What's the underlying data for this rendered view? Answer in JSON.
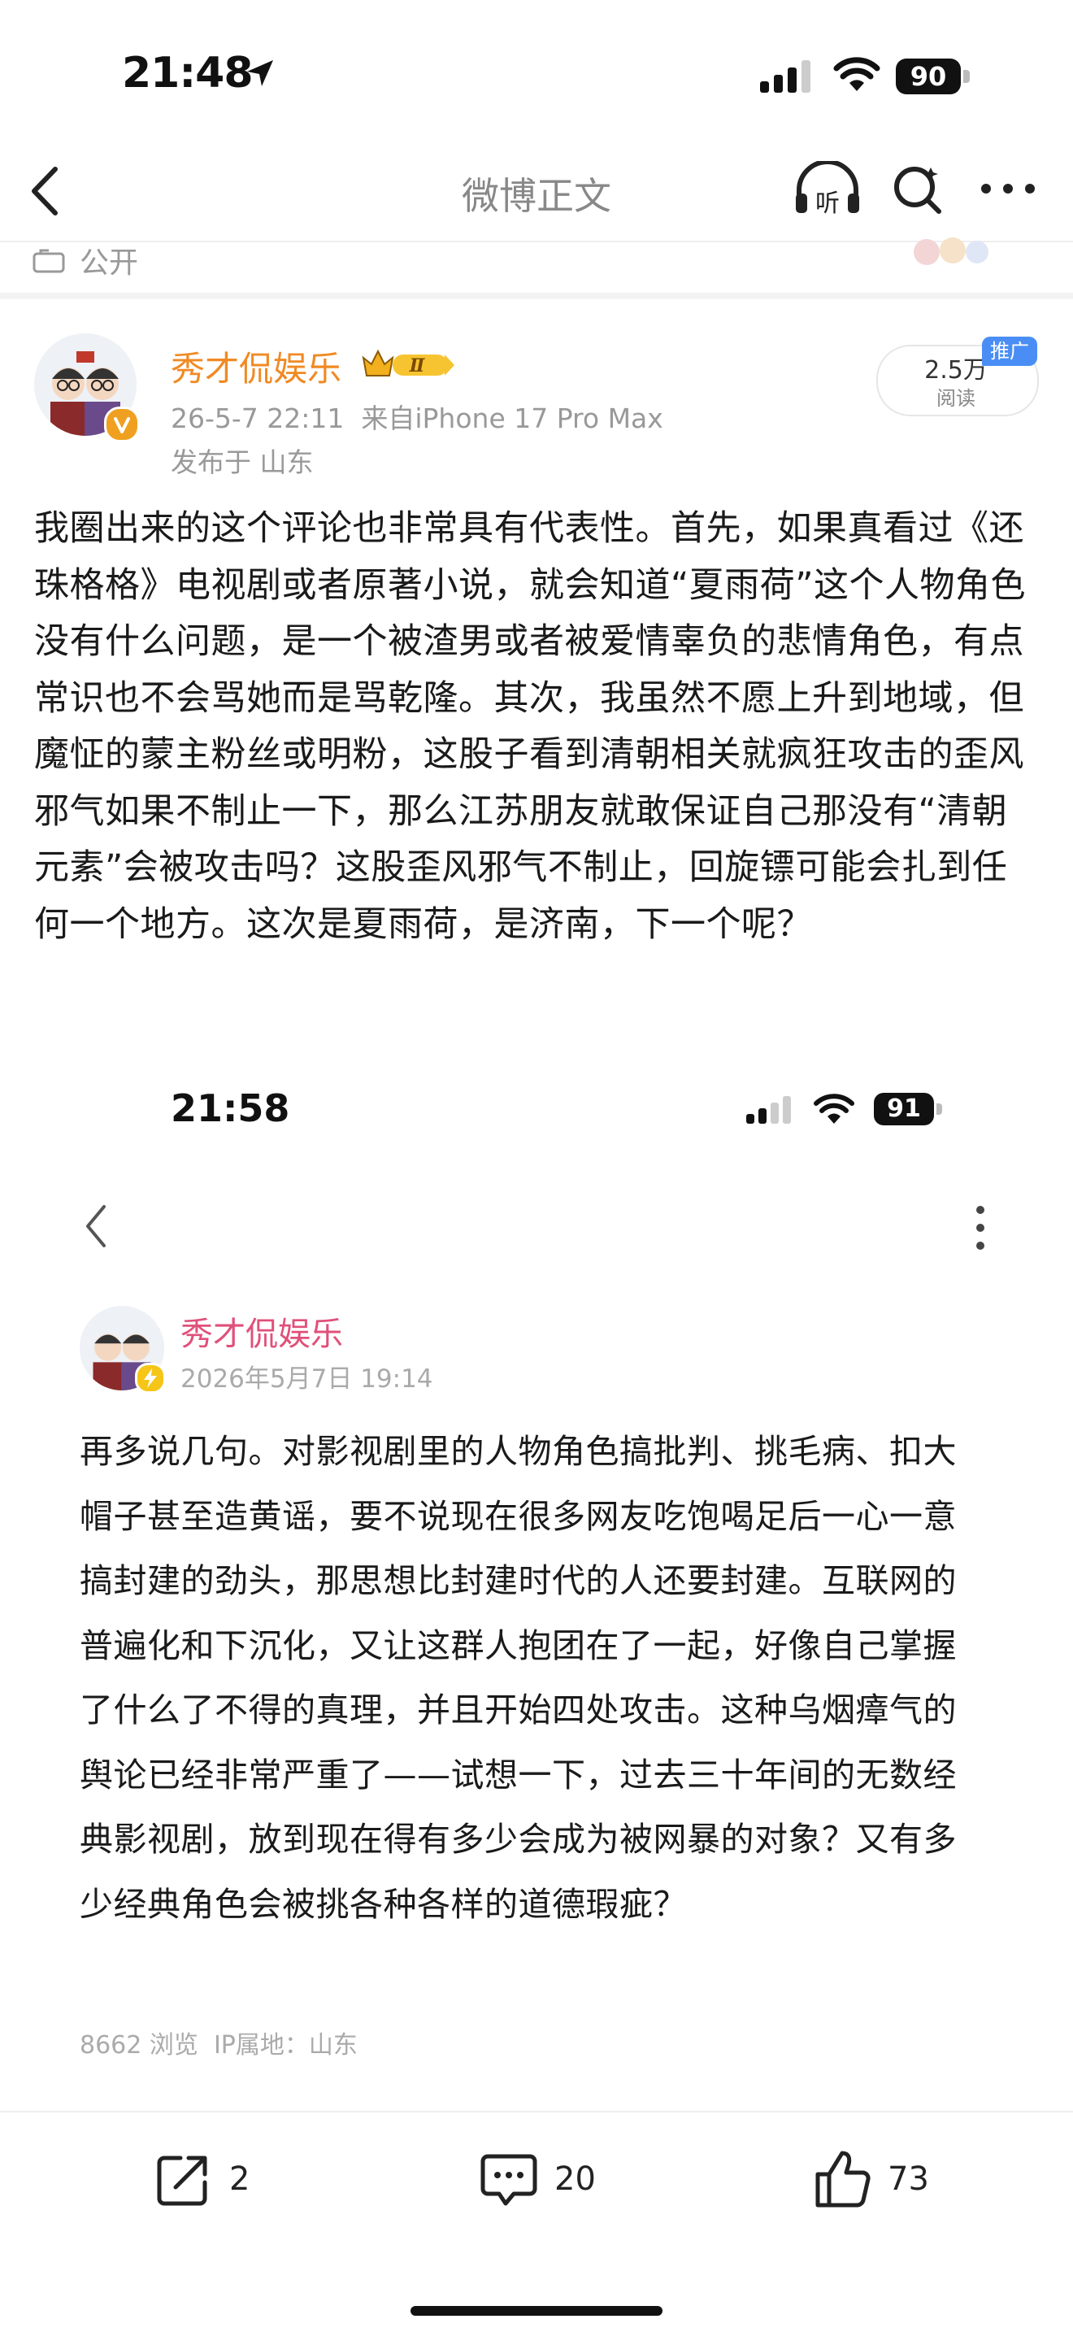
{
  "status_bar": {
    "time": "21:48",
    "battery": "90"
  },
  "nav": {
    "title": "微博正文"
  },
  "visibility": {
    "label": "公开"
  },
  "post": {
    "author": "秀才侃娱乐",
    "vip_level": "Ⅱ",
    "meta": "26-5-7 22:11  来自iPhone 17 Pro Max",
    "location": "发布于 山东",
    "reads": {
      "value": "2.5万",
      "label": "阅读",
      "tag": "推广"
    },
    "body": "我圈出来的这个评论也非常具有代表性。首先，如果真看过《还珠格格》电视剧或者原著小说，就会知道“夏雨荷”这个人物角色没有什么问题，是一个被渣男或者被爱情辜负的悲情角色，有点常识也不会骂她而是骂乾隆。其次，我虽然不愿上升到地域，但魔怔的蒙主粉丝或明粉，这股子看到清朝相关就疯狂攻击的歪风邪气如果不制止一下，那么江苏朋友就敢保证自己那没有“清朝元素”会被攻击吗？这股歪风邪气不制止，回旋镖可能会扎到任何一个地方。这次是夏雨荷，是济南，下一个呢？"
  },
  "embedded": {
    "status_bar": {
      "time": "21:58",
      "battery": "91"
    },
    "author": "秀才侃娱乐",
    "date": "2026年5月7日 19:14",
    "body": "再多说几句。对影视剧里的人物角色搞批判、挑毛病、扣大帽子甚至造黄谣，要不说现在很多网友吃饱喝足后一心一意搞封建的劲头，那思想比封建时代的人还要封建。互联网的普遍化和下沉化，又让这群人抱团在了一起，好像自己掌握了什么了不得的真理，并且开始四处攻击。这种乌烟瘴气的舆论已经非常严重了——试想一下，过去三十年间的无数经典影视剧，放到现在得有多少会成为被网暴的对象？又有多少经典角色会被挑各种各样的道德瑕疵？",
    "stats": "8662 浏览  IP属地：山东"
  },
  "toolbar": {
    "share_count": "2",
    "comment_count": "20",
    "like_count": "73"
  },
  "colors": {
    "author": "#f08a24",
    "embedded_author": "#e0507a",
    "promo": "#4a8ef5",
    "secondary_text": "#999999"
  },
  "icons": [
    "location-arrow-icon",
    "signal-icon",
    "wifi-icon",
    "back-icon",
    "listen-icon",
    "search-icon",
    "more-icon",
    "lock-icon",
    "share-icon",
    "comment-icon",
    "like-icon"
  ]
}
